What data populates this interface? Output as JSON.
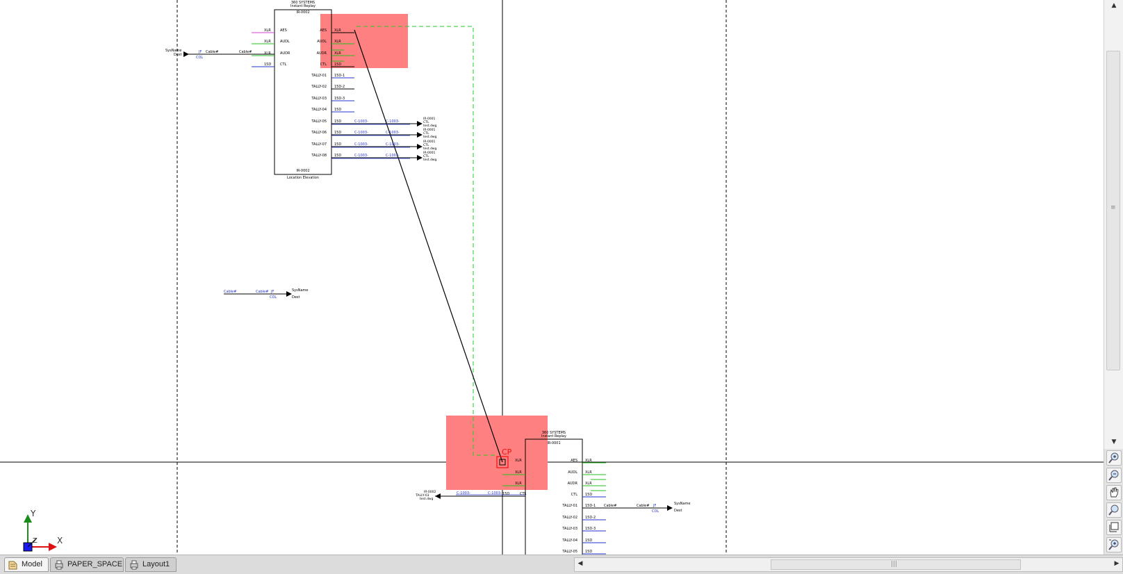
{
  "drawing": {
    "top_block": {
      "header": "360 SYSTEMS",
      "subheader": "Instant Replay",
      "tag": "IR-0002",
      "footer_tag": "IR-0002",
      "location": "Location Elevation",
      "left_pins": [
        "AES",
        "AUDL",
        "AUDR",
        "CTL"
      ],
      "left_types": [
        "XLR",
        "XLR",
        "XLR",
        "15D"
      ],
      "right_pins": [
        "AES",
        "AUDL",
        "AUDR",
        "CTL",
        "TALLY-01",
        "TALLY-02",
        "TALLY-03",
        "TALLY-04",
        "TALLY-05",
        "TALLY-06",
        "TALLY-07",
        "TALLY-08"
      ],
      "right_types": [
        "XLR",
        "XLR",
        "XLR",
        "15D",
        "15D-1",
        "15D-2",
        "15D-3",
        "15D",
        "15D",
        "15D",
        "15D",
        "15D"
      ]
    },
    "bottom_block": {
      "header": "360 SYSTEMS",
      "subheader": "Instant Replay",
      "tag": "IR-0001",
      "left_types": [
        "XLR",
        "XLR",
        "XLR"
      ],
      "right_pins": [
        "AES",
        "AUDL",
        "AUDR",
        "CTL",
        "TALLY-01",
        "TALLY-02",
        "TALLY-03",
        "TALLY-04",
        "TALLY-05"
      ],
      "right_types": [
        "XLR",
        "XLR",
        "XLR",
        "15D",
        "15D-1",
        "15D-2",
        "15D-3",
        "15D",
        "15D"
      ]
    },
    "cable_label": "Cable#",
    "cable_id": "C-1003-",
    "jf_label": "JF",
    "col_label": "COL",
    "sys_label": "SysName",
    "dest_label": "Dest",
    "offpage_refs": [
      "IR-0001",
      "CTL",
      "test.dwg"
    ],
    "offpage_ref_bottom": [
      "IR-0002",
      "TALLY-03",
      "test.dwg"
    ],
    "cable_mid": "C-1003-",
    "cable_mid2": "C-1003-",
    "snap_marker": "CP",
    "ucs": {
      "y": "Y",
      "x": "X",
      "z": "Z"
    }
  },
  "tabs": [
    {
      "label": "Model",
      "active": true
    },
    {
      "label": "PAPER_SPACE",
      "active": false
    },
    {
      "label": "Layout1",
      "active": false
    }
  ],
  "nav_tools": [
    "zoom-in-icon",
    "zoom-out-icon",
    "pan-hand-icon",
    "zoom-window-icon",
    "zoom-extents-icon",
    "zoom-realtime-icon"
  ],
  "colors": {
    "highlight": "#ff8080",
    "wire_green": "#22c022",
    "wire_blue": "#2233cc",
    "wire_magenta": "#d040d0",
    "dashed_green": "#22cc22",
    "marker_red": "#ee1111"
  }
}
